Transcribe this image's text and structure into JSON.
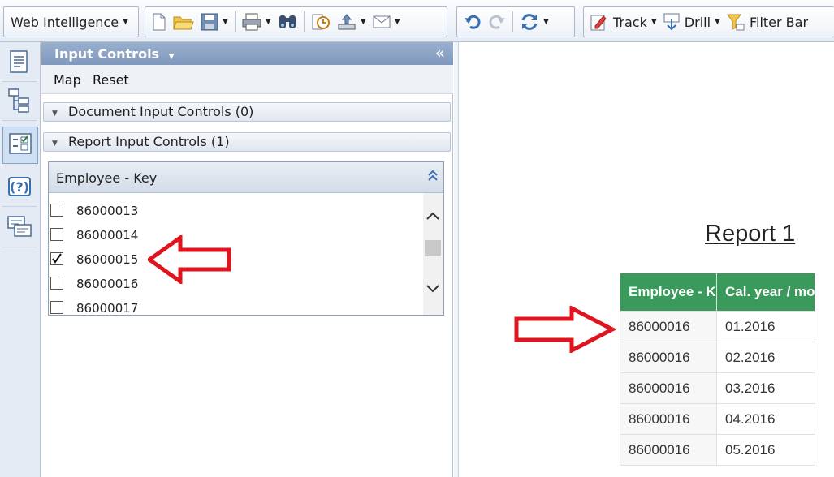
{
  "toolbar": {
    "app_label": "Web Intelligence",
    "track_label": "Track",
    "drill_label": "Drill",
    "filter_bar_label": "Filter Bar",
    "icons": [
      "new-document-icon",
      "open-folder-icon",
      "save-icon",
      "print-icon",
      "find-icon",
      "refresh-schedule-icon",
      "export-icon",
      "email-icon",
      "undo-icon",
      "redo-icon",
      "refresh-data-icon",
      "track-icon",
      "drill-icon",
      "filter-bar-icon"
    ]
  },
  "side_icons": [
    "document-summary-icon",
    "data-tree-icon",
    "input-controls-icon",
    "help-icon",
    "comments-icon"
  ],
  "panel": {
    "title": "Input Controls",
    "collapse_glyph": "«",
    "map_label": "Map",
    "reset_label": "Reset",
    "document_section": "Document Input Controls (0)",
    "report_section": "Report Input Controls (1)",
    "control": {
      "title": "Employee - Key",
      "items": [
        {
          "value": "86000013",
          "checked": false
        },
        {
          "value": "86000014",
          "checked": false
        },
        {
          "value": "86000015",
          "checked": true
        },
        {
          "value": "86000016",
          "checked": false
        },
        {
          "value": "86000017",
          "checked": false
        }
      ]
    }
  },
  "report": {
    "title": "Report 1",
    "columns": [
      "Employee - Key",
      "Cal. year / month"
    ],
    "rows": [
      [
        "86000016",
        "01.2016"
      ],
      [
        "86000016",
        "02.2016"
      ],
      [
        "86000016",
        "03.2016"
      ],
      [
        "86000016",
        "04.2016"
      ],
      [
        "86000016",
        "05.2016"
      ]
    ]
  },
  "colors": {
    "header_green": "#3a9a5b",
    "annotation_red": "#e0141e",
    "panel_header_blue": "#8aa3c6"
  }
}
